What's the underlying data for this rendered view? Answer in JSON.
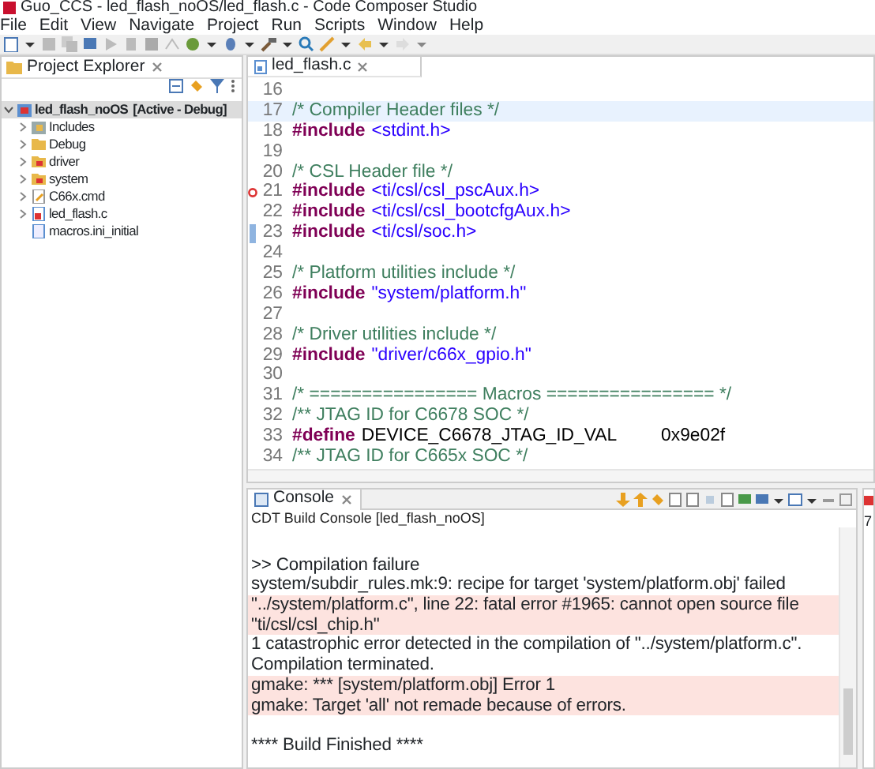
{
  "window": {
    "title": "Guo_CCS - led_flash_noOS/led_flash.c - Code Composer Studio"
  },
  "menu": [
    "File",
    "Edit",
    "View",
    "Navigate",
    "Project",
    "Run",
    "Scripts",
    "Window",
    "Help"
  ],
  "project_explorer": {
    "tab": "Project Explorer",
    "items": [
      {
        "name": "led_flash_noOS",
        "suffix": "[Active - Debug]",
        "kind": "project",
        "expanded": true,
        "selected": true,
        "children": [
          {
            "name": "Includes",
            "kind": "includes",
            "expanded": false,
            "selected": false
          },
          {
            "name": "Debug",
            "kind": "folder",
            "expanded": false,
            "selected": false
          },
          {
            "name": "driver",
            "kind": "source-folder",
            "expanded": false,
            "selected": false
          },
          {
            "name": "system",
            "kind": "source-folder",
            "expanded": false,
            "selected": false
          },
          {
            "name": "C66x.cmd",
            "kind": "cmd-file",
            "expanded": false,
            "selected": false
          },
          {
            "name": "led_flash.c",
            "kind": "c-file",
            "expanded": false,
            "selected": false
          },
          {
            "name": "macros.ini_initial",
            "kind": "text-file",
            "selected": false
          }
        ]
      }
    ]
  },
  "editor": {
    "tab": "led_flash.c",
    "lines": [
      {
        "number": "16",
        "current": false
      },
      {
        "number": "17",
        "current": true,
        "tokens": [
          {
            "kind": "comment",
            "text": "/* Compiler Header files */"
          }
        ]
      },
      {
        "number": "18",
        "current": false,
        "tokens": [
          {
            "kind": "directive",
            "text": "#include"
          },
          {
            "kind": "header",
            "text": "<stdint.h>"
          }
        ]
      },
      {
        "number": "19",
        "current": false
      },
      {
        "number": "20",
        "current": false,
        "tokens": [
          {
            "kind": "comment",
            "text": "/* CSL Header file */"
          }
        ]
      },
      {
        "number": "21",
        "current": false,
        "error_marker": true,
        "tokens": [
          {
            "kind": "directive",
            "text": "#include"
          },
          {
            "kind": "header",
            "text": "<ti/csl/csl_pscAux.h>"
          }
        ]
      },
      {
        "number": "22",
        "current": false,
        "tokens": [
          {
            "kind": "directive",
            "text": "#include"
          },
          {
            "kind": "header",
            "text": "<ti/csl/csl_bootcfgAux.h>"
          }
        ]
      },
      {
        "number": "23",
        "current": false,
        "change_marker": true,
        "tokens": [
          {
            "kind": "directive",
            "text": "#include"
          },
          {
            "kind": "header",
            "text": "<ti/csl/soc.h>"
          }
        ]
      },
      {
        "number": "24",
        "current": false
      },
      {
        "number": "25",
        "current": false,
        "tokens": [
          {
            "kind": "comment",
            "text": "/* Platform utilities include */"
          }
        ]
      },
      {
        "number": "26",
        "current": false,
        "tokens": [
          {
            "kind": "directive",
            "text": "#include"
          },
          {
            "kind": "header",
            "text": "\"system/platform.h\""
          }
        ]
      },
      {
        "number": "27",
        "current": false
      },
      {
        "number": "28",
        "current": false,
        "tokens": [
          {
            "kind": "comment",
            "text": "/* Driver utilities include */"
          }
        ]
      },
      {
        "number": "29",
        "current": false,
        "tokens": [
          {
            "kind": "directive",
            "text": "#include"
          },
          {
            "kind": "header",
            "text": "\"driver/c66x_gpio.h\""
          }
        ]
      },
      {
        "number": "30",
        "current": false
      },
      {
        "number": "31",
        "current": false,
        "tokens": [
          {
            "kind": "comment",
            "text": "/* ================ Macros ================ */"
          }
        ]
      },
      {
        "number": "32",
        "current": false,
        "tokens": [
          {
            "kind": "comment",
            "text": "/** JTAG ID for C6678 SOC */"
          }
        ]
      },
      {
        "number": "33",
        "current": false,
        "tokens": [
          {
            "kind": "directive",
            "text": "#define"
          },
          {
            "kind": "plain",
            "text": "DEVICE_C6678_JTAG_ID_VAL"
          },
          {
            "kind": "plain",
            "text": "0x9e02f"
          }
        ]
      },
      {
        "number": "34",
        "current": false,
        "tokens": [
          {
            "kind": "comment",
            "text": "/** JTAG ID for C665x SOC */"
          }
        ]
      }
    ]
  },
  "console": {
    "tab": "Console",
    "subtitle": "CDT Build Console [led_flash_noOS]",
    "lines": [
      {
        "kind": "blank"
      },
      {
        "kind": "normal",
        "text": ">> Compilation failure"
      },
      {
        "kind": "normal",
        "text": "system/subdir_rules.mk:9: recipe for target 'system/platform.obj' failed"
      },
      {
        "kind": "error",
        "text": "\"../system/platform.c\", line 22: fatal error #1965: cannot open source file"
      },
      {
        "kind": "error",
        "text": "\"ti/csl/csl_chip.h\""
      },
      {
        "kind": "normal",
        "text": "1 catastrophic error detected in the compilation of \"../system/platform.c\"."
      },
      {
        "kind": "normal",
        "text": "Compilation terminated."
      },
      {
        "kind": "error",
        "text": "gmake: *** [system/platform.obj] Error 1"
      },
      {
        "kind": "error",
        "text": "gmake: Target 'all' not remade because of errors."
      },
      {
        "kind": "blank"
      },
      {
        "kind": "normal",
        "text": "**** Build Finished ****"
      }
    ]
  },
  "side_panel": {
    "text": "7"
  }
}
